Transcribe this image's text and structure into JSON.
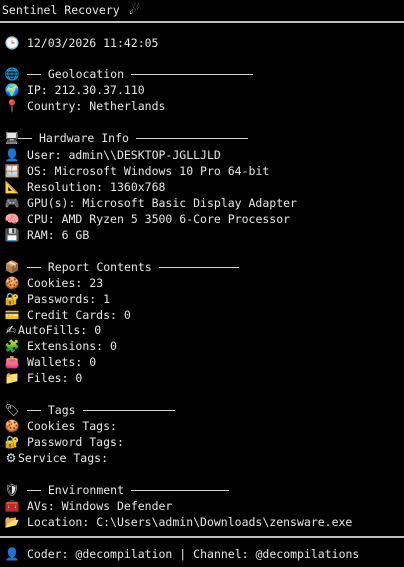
{
  "title": "Sentinel Recovery",
  "title_icon": "comet-icon",
  "timestamp": "12/03/2026 11:42:05",
  "geolocation": {
    "header": "Geolocation",
    "ip_label": "IP:",
    "ip": "212.30.37.110",
    "country_label": "Country:",
    "country": "Netherlands"
  },
  "hardware": {
    "header": "Hardware Info",
    "user_label": "User:",
    "user": "admin\\\\DESKTOP-JGLLJLD",
    "os_label": "OS:",
    "os": "Microsoft Windows 10 Pro 64-bit",
    "resolution_label": "Resolution:",
    "resolution": "1360x768",
    "gpu_label": "GPU(s):",
    "gpu": "Microsoft Basic Display Adapter",
    "cpu_label": "CPU:",
    "cpu": "AMD Ryzen 5 3500 6-Core Processor",
    "ram_label": "RAM:",
    "ram": "6 GB"
  },
  "report": {
    "header": "Report Contents",
    "cookies_label": "Cookies:",
    "cookies": "23",
    "passwords_label": "Passwords:",
    "passwords": "1",
    "cards_label": "Credit Cards:",
    "cards": "0",
    "autofills_label": "AutoFills:",
    "autofills": "0",
    "extensions_label": "Extensions:",
    "extensions": "0",
    "wallets_label": "Wallets:",
    "wallets": "0",
    "files_label": "Files:",
    "files": "0"
  },
  "tags": {
    "header": "Tags",
    "cookie_tags_label": "Cookies Tags:",
    "password_tags_label": "Password Tags:",
    "service_tags_label": "Service Tags:"
  },
  "environment": {
    "header": "Environment",
    "avs_label": "AVs:",
    "avs": "Windows Defender",
    "location_label": "Location:",
    "location": "C:\\Users\\admin\\Downloads\\zensware.exe"
  },
  "footer": {
    "coder_label": "Coder:",
    "coder": "@decompilation",
    "separator": "|",
    "channel_label": "Channel:",
    "channel": "@decompilations"
  },
  "colors": {
    "background": "#000000",
    "text": "#e6e6e6",
    "rule": "#bfbfbf"
  }
}
